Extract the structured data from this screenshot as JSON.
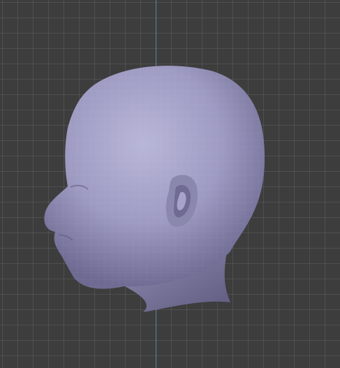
{
  "viewport": {
    "background_color": "#3d3d3d",
    "grid_color": "#4a4a4a",
    "axis_color": "#5a8fb0"
  },
  "model": {
    "icon": "head-mesh-icon",
    "material_color": "#8f8cb2",
    "highlight_color": "#b8b6d8",
    "shadow_color": "#5e5b7e"
  }
}
